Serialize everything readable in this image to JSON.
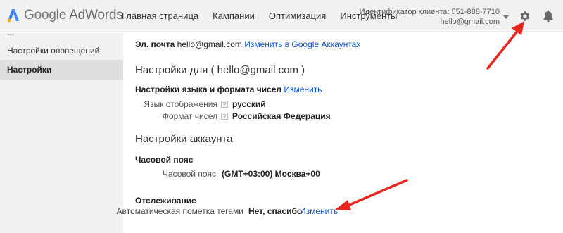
{
  "app": {
    "logo_google": "Google",
    "logo_product": "AdWords"
  },
  "nav": [
    "Главная страница",
    "Кампании",
    "Оптимизация",
    "Инструменты"
  ],
  "client": {
    "id_line": "Идентификатор клиента: 551-888-7710",
    "email": "hello@gmail.com"
  },
  "sidebar": {
    "fragment": "...",
    "items": [
      {
        "label": "Настройки оповещений"
      },
      {
        "label": "Настройки"
      }
    ]
  },
  "email_row": {
    "label": "Эл. почта",
    "value": "hello@gmail.com",
    "link": "Изменить в Google Аккаунтах"
  },
  "settings_for": "Настройки для ( hello@gmail.com )",
  "lang_section": {
    "title": "Настройки языка и формата чисел",
    "change": "Изменить",
    "display_language_label": "Язык отображения",
    "display_language_value": "русский",
    "number_format_label": "Формат чисел",
    "number_format_value": "Российская Федерация",
    "help": "?"
  },
  "account_settings": "Настройки аккаунта",
  "timezone": {
    "title": "Часовой пояс",
    "label": "Часовой пояс",
    "value": "(GMT+03:00) Москва+00"
  },
  "tracking": {
    "title": "Отслеживание",
    "label": "Автоматическая пометка тегами",
    "value": "Нет, спасибо",
    "change": "Изменить"
  },
  "colors": {
    "accent": "#1155cc",
    "arrow": "#e8261f",
    "sidebar_bg": "#f1f1f1"
  },
  "icons": [
    "adwords-logo-icon",
    "chevron-down-icon",
    "gear-icon",
    "bell-icon",
    "help-icon"
  ]
}
